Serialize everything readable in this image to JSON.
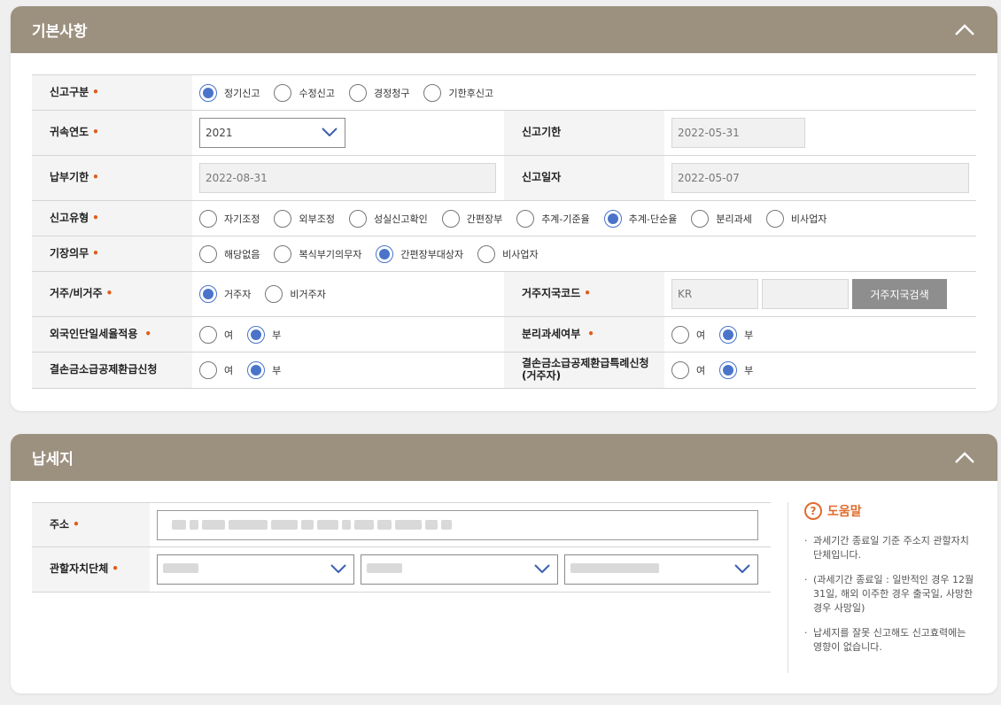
{
  "basic": {
    "title": "기본사항",
    "report_type": {
      "label": "신고구분",
      "options": [
        "정기신고",
        "수정신고",
        "경정청구",
        "기한후신고"
      ],
      "selected": 0
    },
    "year": {
      "label": "귀속연도",
      "value": "2021"
    },
    "report_deadline": {
      "label": "신고기한",
      "value": "2022-05-31"
    },
    "payment_deadline": {
      "label": "납부기한",
      "value": "2022-08-31"
    },
    "report_date": {
      "label": "신고일자",
      "value": "2022-05-07"
    },
    "report_kind": {
      "label": "신고유형",
      "options": [
        "자기조정",
        "외부조정",
        "성실신고확인",
        "간편장부",
        "추계-기준율",
        "추계-단순율",
        "분리과세",
        "비사업자"
      ],
      "selected": 5
    },
    "bookkeeping": {
      "label": "기장의무",
      "options": [
        "해당없음",
        "복식부기의무자",
        "간편장부대상자",
        "비사업자"
      ],
      "selected": 2
    },
    "residency": {
      "label": "거주/비거주",
      "options": [
        "거주자",
        "비거주자"
      ],
      "selected": 0
    },
    "country_code": {
      "label": "거주지국코드",
      "value": "KR",
      "value2": "",
      "search_btn": "거주지국검색"
    },
    "foreign_flat_tax": {
      "label": "외국인단일세율적용",
      "options": [
        "여",
        "부"
      ],
      "selected": 1
    },
    "separate_tax": {
      "label": "분리과세여부",
      "options": [
        "여",
        "부"
      ],
      "selected": 1
    },
    "loss_carryback": {
      "label": "결손금소급공제환급신청",
      "options": [
        "여",
        "부"
      ],
      "selected": 1
    },
    "loss_carryback_special": {
      "label_line1": "결손금소급공제환급특례신청",
      "label_line2": "(거주자)",
      "options": [
        "여",
        "부"
      ],
      "selected": 1
    }
  },
  "address": {
    "title": "납세지",
    "addr_label": "주소",
    "region_label": "관할자치단체"
  },
  "help": {
    "title": "도움말",
    "items": [
      "과세기간 종료일 기준 주소지 관할자치단체입니다.",
      "(과세기간 종료일 : 일반적인 경우 12월31일, 해외 이주한 경우 출국일, 사망한 경우 사망일)",
      "납세지를 잘못 신고해도 신고효력에는 영향이 없습니다."
    ]
  },
  "colors": {
    "header": "#9c907f",
    "accent": "#4a74c9",
    "required": "#e05c1c",
    "help": "#e06b2c"
  }
}
